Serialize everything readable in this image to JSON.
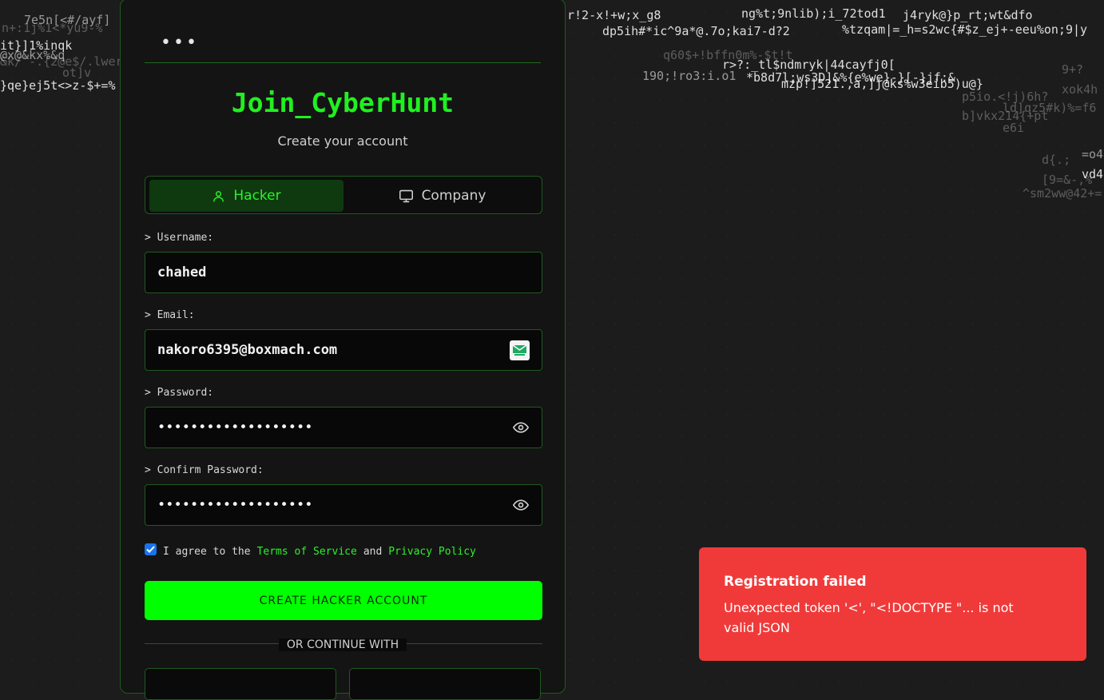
{
  "background_rain": [
    "7e5n[<#/ayf]",
    "n+:1j%1<*yu9-%",
    "it}]1%inqk",
    "&k/`-.{2@e$/.lwera",
    "@x@&kx%&q",
    "ot]v",
    "}qe}ej5t<>z-$+=%",
    "r!2-x!+w;x_g8",
    "ng%t;9nlib);i_72tod1",
    "j4ryk@}p_rt;wt&dfo",
    "dp5ih#*ic^9a*@.7o;kai7-d?2",
    "%tzqam|=_h=s2wc{#$z_ej+-eeu%on;9|y",
    "q60$+!bffn0m%-$t!t",
    "r>?:_tl$ndmryk|44cayfj0[",
    "*b8d7l;ws3D]&%{e%we}-}[-}jf:&",
    "mzp!]521.,a,]j@ks%w3eib5)u@}",
    "190;!ro3:i.o1",
    "p5io.<!j)6h?",
    "ld]qz5#k)%=f6",
    "b]vkx214{+pt",
    "e6i",
    "d{.;",
    "[9=&-,%",
    "^sm2ww@42+=",
    "9+?",
    "xok4h",
    "=o4",
    "vd4"
  ],
  "card": {
    "menu_dots": "•••",
    "title": "Join_CyberHunt",
    "subtitle": "Create your account",
    "tabs": [
      {
        "label": "Hacker",
        "icon": "user-icon",
        "active": true
      },
      {
        "label": "Company",
        "icon": "monitor-icon",
        "active": false
      }
    ],
    "fields": {
      "username": {
        "label": "> Username:",
        "value": "chahed"
      },
      "email": {
        "label": "> Email:",
        "value": "nakoro6395@boxmach.com",
        "icon": "tempmail-extension-icon"
      },
      "password": {
        "label": "> Password:",
        "value": "•••••••••••••••••••",
        "icon": "eye-icon"
      },
      "confirm": {
        "label": "> Confirm Password:",
        "value": "•••••••••••••••••••",
        "icon": "eye-icon"
      }
    },
    "agree": {
      "checked": true,
      "prefix": "I agree to the",
      "terms": "Terms of Service",
      "and": "and",
      "privacy": "Privacy Policy"
    },
    "submit_label": "CREATE HACKER ACCOUNT",
    "divider_label": "OR CONTINUE WITH"
  },
  "toast": {
    "title": "Registration failed",
    "message": "Unexpected token '<', \"<!DOCTYPE \"... is not valid JSON",
    "color": "#f03a3a"
  },
  "colors": {
    "accent": "#00ff00",
    "background": "#1c1c1c",
    "card": "#141414",
    "border": "#1f5a1f"
  }
}
